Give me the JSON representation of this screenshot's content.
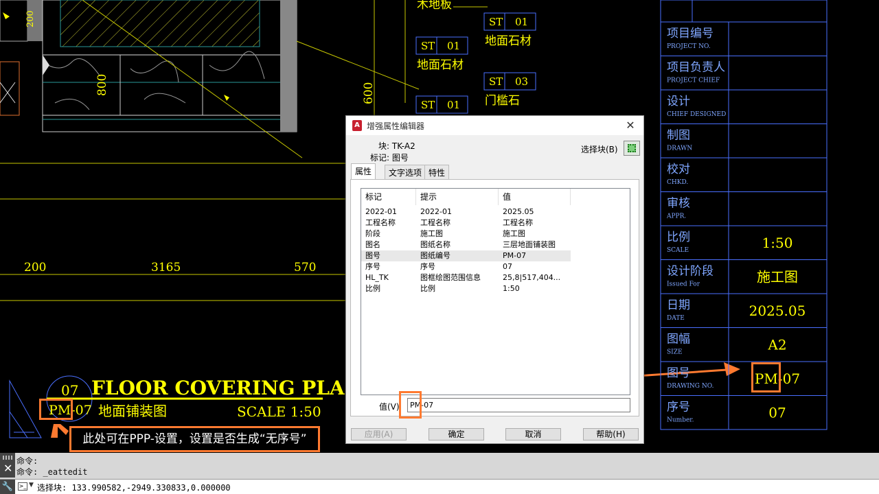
{
  "drawing": {
    "labels": {
      "wood_floor": "木地板",
      "stone_floor": "地面石材",
      "threshold_stone": "门槛石"
    },
    "material_tags": [
      {
        "code": "ST",
        "num": "01"
      },
      {
        "code": "ST",
        "num": "01"
      },
      {
        "code": "ST",
        "num": "03"
      },
      {
        "code": "ST",
        "num": "01"
      }
    ],
    "dimensions": {
      "d200": "200",
      "d3165": "3165",
      "d570": "570",
      "d800": "800",
      "d600": "600",
      "d200_top": "200"
    },
    "plan_title": {
      "number": "07",
      "drawing_no": "PM-07",
      "title_en": "FLOOR COVERING PLAN",
      "title_cn": "地面铺装图",
      "scale": "SCALE 1:50"
    }
  },
  "title_block": {
    "rows": [
      {
        "cn": "项目编号",
        "en": "PROJECT NO.",
        "value": ""
      },
      {
        "cn": "项目负责人",
        "en": "PROJECT CHIEF",
        "value": ""
      },
      {
        "cn": "设计",
        "en": "CHIEF DESIGNED",
        "value": ""
      },
      {
        "cn": "制图",
        "en": "DRAWN",
        "value": ""
      },
      {
        "cn": "校对",
        "en": "CHKD.",
        "value": ""
      },
      {
        "cn": "审核",
        "en": "APPR.",
        "value": ""
      },
      {
        "cn": "比例",
        "en": "SCALE",
        "value": "1:50"
      },
      {
        "cn": "设计阶段",
        "en": "Issued For",
        "value": "施工图"
      },
      {
        "cn": "日期",
        "en": "DATE",
        "value": "2025.05"
      },
      {
        "cn": "图幅",
        "en": "SIZE",
        "value": "A2"
      },
      {
        "cn": "图号",
        "en": "DRAWING NO.",
        "value": "PM-07"
      },
      {
        "cn": "序号",
        "en": "Number.",
        "value": "07"
      }
    ]
  },
  "dialog": {
    "app_icon": "A",
    "title": "增强属性编辑器",
    "block_label": "块: TK-A2",
    "tag_label": "标记: 图号",
    "select_block": "选择块(B)",
    "tabs": [
      "属性",
      "文字选项",
      "特性"
    ],
    "headers": [
      "标记",
      "提示",
      "值"
    ],
    "rows": [
      {
        "tag": "2022-01",
        "prompt": "2022-01",
        "value": "2025.05"
      },
      {
        "tag": "工程名称",
        "prompt": "工程名称",
        "value": "工程名称"
      },
      {
        "tag": "阶段",
        "prompt": "施工图",
        "value": "施工图"
      },
      {
        "tag": "图名",
        "prompt": "图纸名称",
        "value": "三层地面铺装图"
      },
      {
        "tag": "图号",
        "prompt": "图纸编号",
        "value": "PM-07"
      },
      {
        "tag": "序号",
        "prompt": "序号",
        "value": "07"
      },
      {
        "tag": "HL_TK",
        "prompt": "图框绘图范围信息",
        "value": "25,8|517,404..."
      },
      {
        "tag": "比例",
        "prompt": "比例",
        "value": "1:50"
      }
    ],
    "selected_row": 4,
    "value_label": "值(V)",
    "value_input": "PM-07",
    "buttons": {
      "apply": "应用(A)",
      "ok": "确定",
      "cancel": "取消",
      "help": "帮助(H)"
    }
  },
  "annotation": {
    "text": "此处可在PPP-设置，设置是否生成“无序号”"
  },
  "command": {
    "history": [
      "命令:",
      "命令: _eattedit"
    ],
    "current": "选择块: 133.990582,-2949.330833,0.000000"
  },
  "colors": {
    "cad_yellow": "#ffff00",
    "cad_blue": "#4a6fff",
    "highlight": "#ff7a30"
  }
}
